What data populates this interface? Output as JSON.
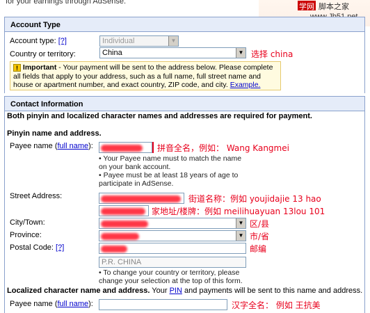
{
  "top_text": "for your earnings through AdSense.",
  "watermark": {
    "part1": "学网",
    "part2": "脚本之家",
    "url": "www.Jb51.net"
  },
  "account": {
    "title": "Account Type",
    "type_label": "Account type:",
    "type_help": "[?]",
    "type_value": "Individual",
    "country_label": "Country or territory:",
    "country_value": "China",
    "country_note": "选择 china",
    "important_title": "Important",
    "important_text": " - Your payment will be sent to the address below. Please complete all fields that apply to your address, such as a full name, full street name and house or apartment number, and exact country, ZIP code, and city. ",
    "important_link": "Example."
  },
  "contact": {
    "title": "Contact Information",
    "intro": "Both pinyin and localized character names and addresses are required for payment.",
    "pinyin_heading": "Pinyin name and address.",
    "payee_label": "Payee name",
    "payee_link": "full name",
    "payee_note": "拼音全名，例如： Wang Kangmei",
    "payee_hint1": "• Your Payee name must to match the name on your bank account.",
    "payee_hint2": "• Payee must be at least 18 years of age to participate in AdSense.",
    "street_label": "Street Address:",
    "street_note1": "街道名称：例如 youjidajie 13 hao",
    "street_note2": "家地址/楼牌：例如 meilihuayuan 13lou 101",
    "city_label": "City/Town:",
    "city_note": "区/县",
    "province_label": "Province:",
    "province_note": "市/省",
    "postal_label": "Postal Code:",
    "postal_help": "[?]",
    "postal_note": "邮编",
    "country_display": "P.R. CHINA",
    "country_hint": "• To change your country or territory, please change your selection at the top of this form.",
    "localized_heading": "Localized character name and address.",
    "localized_text1": " Your ",
    "localized_link": "PIN",
    "localized_text2": " and payments will be sent to this name and address.",
    "local_payee_label": "Payee name",
    "local_payee_link": "full name",
    "local_payee_note": "汉字全名：  例如  王抗美"
  }
}
